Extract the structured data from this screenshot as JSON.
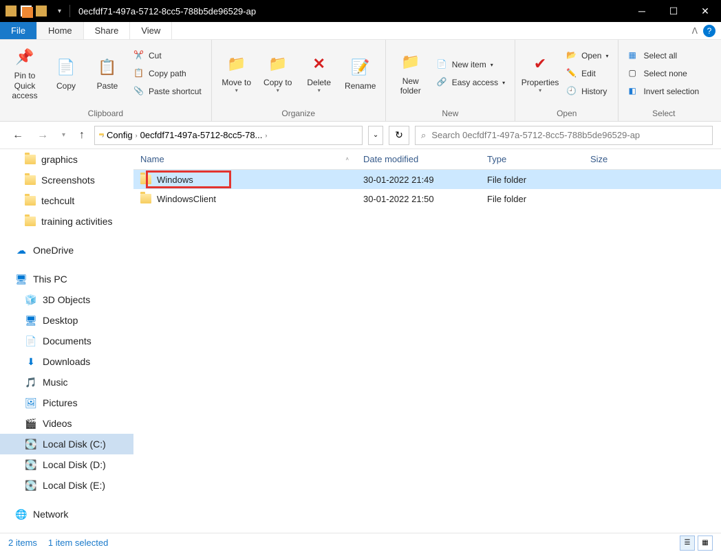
{
  "title": "0ecfdf71-497a-5712-8cc5-788b5de96529-ap",
  "tabs": {
    "file": "File",
    "home": "Home",
    "share": "Share",
    "view": "View"
  },
  "ribbon": {
    "clipboard": {
      "label": "Clipboard",
      "pin": "Pin to Quick access",
      "copy": "Copy",
      "paste": "Paste",
      "cut": "Cut",
      "copypath": "Copy path",
      "pasteshortcut": "Paste shortcut"
    },
    "organize": {
      "label": "Organize",
      "moveto": "Move to",
      "copyto": "Copy to",
      "delete": "Delete",
      "rename": "Rename"
    },
    "new": {
      "label": "New",
      "newfolder": "New folder",
      "newitem": "New item",
      "easyaccess": "Easy access"
    },
    "open": {
      "label": "Open",
      "properties": "Properties",
      "open": "Open",
      "edit": "Edit",
      "history": "History"
    },
    "select": {
      "label": "Select",
      "selectall": "Select all",
      "selectnone": "Select none",
      "invert": "Invert selection"
    }
  },
  "breadcrumb": {
    "seg1": "Config",
    "seg2": "0ecfdf71-497a-5712-8cc5-78..."
  },
  "search_placeholder": "Search 0ecfdf71-497a-5712-8cc5-788b5de96529-ap",
  "tree": {
    "graphics": "graphics",
    "screenshots": "Screenshots",
    "techcult": "techcult",
    "training": "training activities",
    "onedrive": "OneDrive",
    "thispc": "This PC",
    "obj3d": "3D Objects",
    "desktop": "Desktop",
    "documents": "Documents",
    "downloads": "Downloads",
    "music": "Music",
    "pictures": "Pictures",
    "videos": "Videos",
    "diskc": "Local Disk (C:)",
    "diskd": "Local Disk (D:)",
    "diske": "Local Disk (E:)",
    "network": "Network"
  },
  "columns": {
    "name": "Name",
    "date": "Date modified",
    "type": "Type",
    "size": "Size"
  },
  "files": [
    {
      "name": "Windows",
      "date": "30-01-2022 21:49",
      "type": "File folder",
      "size": ""
    },
    {
      "name": "WindowsClient",
      "date": "30-01-2022 21:50",
      "type": "File folder",
      "size": ""
    }
  ],
  "status": {
    "items": "2 items",
    "selected": "1 item selected"
  }
}
